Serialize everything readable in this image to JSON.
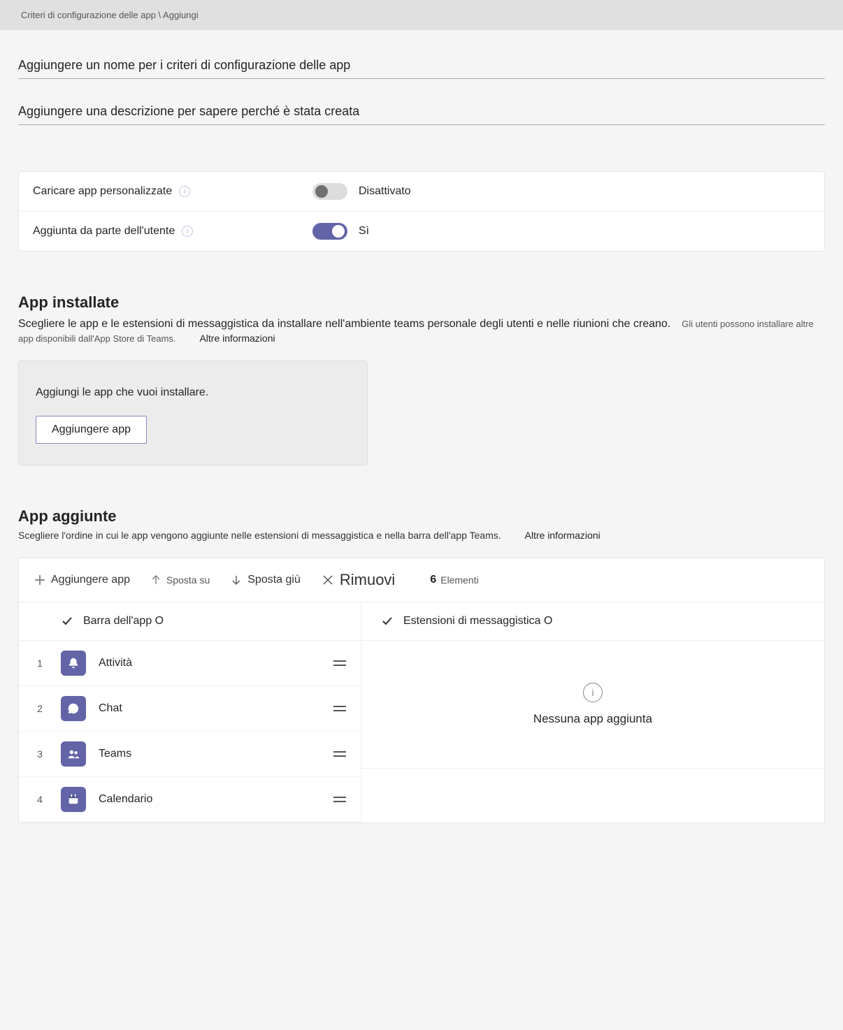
{
  "breadcrumb": "Criteri di configurazione delle app \\ Aggiungi",
  "name_placeholder": "Aggiungere un nome per i criteri di configurazione delle app",
  "desc_placeholder": "Aggiungere una descrizione per sapere perché è stata creata",
  "toggles": {
    "upload": {
      "label": "Caricare app personalizzate",
      "value": "Disattivato",
      "on": false
    },
    "userpin": {
      "label": "Aggiunta da parte dell'utente",
      "value": "Sì",
      "on": true
    }
  },
  "installed": {
    "title": "App installate",
    "desc": "Scegliere le app e le estensioni di messaggistica da installare nell'ambiente teams personale degli utenti e nelle riunioni che creano.",
    "sub": "Gli utenti possono installare altre app disponibili dall'App Store di Teams.",
    "link": "Altre informazioni",
    "box_msg": "Aggiungi le app che vuoi installare.",
    "box_btn": "Aggiungere app"
  },
  "pinned": {
    "title": "App aggiunte",
    "desc": "Scegliere l'ordine in cui le app vengono aggiunte nelle estensioni di messaggistica e nella barra dell'app Teams.",
    "link": "Altre informazioni",
    "toolbar": {
      "add": "Aggiungere app",
      "up": "Sposta su",
      "down": "Sposta giù",
      "remove": "Rimuovi",
      "count_num": "6",
      "count_lbl": "Elementi"
    },
    "col_appbar": "Barra dell'app O",
    "col_ext": "Estensioni di messaggistica O",
    "empty": "Nessuna app aggiunta",
    "apps": [
      {
        "ord": "1",
        "name": "Attività",
        "icon": "bell"
      },
      {
        "ord": "2",
        "name": "Chat",
        "icon": "chat"
      },
      {
        "ord": "3",
        "name": "Teams",
        "icon": "people"
      },
      {
        "ord": "4",
        "name": "Calendario",
        "icon": "calendar"
      }
    ]
  }
}
